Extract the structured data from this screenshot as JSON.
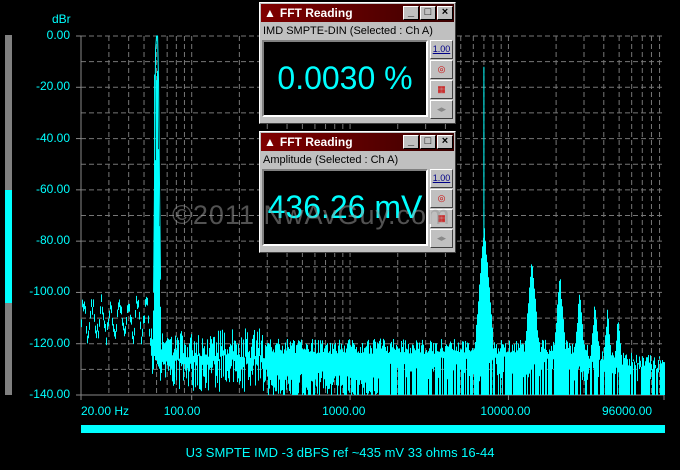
{
  "chart_data": {
    "type": "line",
    "ylabel": "dBr",
    "ylim": [
      -140,
      0
    ],
    "xlim": [
      20,
      96000
    ],
    "xscale": "log",
    "grid": true,
    "yticks": [
      "0.00",
      "-20.00",
      "-40.00",
      "-60.00",
      "-80.00",
      "-100.00",
      "-120.00",
      "-140.00"
    ],
    "xticks": [
      {
        "v": 20,
        "label": "20.00 Hz"
      },
      {
        "v": 100,
        "label": "100.00"
      },
      {
        "v": 1000,
        "label": "1000.00"
      },
      {
        "v": 10000,
        "label": "10000.00"
      },
      {
        "v": 96000,
        "label": "96000.00"
      }
    ],
    "peaks": [
      {
        "x": 60,
        "y": 0
      },
      {
        "x": 7000,
        "y": -72
      },
      {
        "x": 14000,
        "y": -85
      },
      {
        "x": 21000,
        "y": -92
      },
      {
        "x": 28000,
        "y": -98
      },
      {
        "x": 35000,
        "y": -102
      },
      {
        "x": 42000,
        "y": -105
      },
      {
        "x": 49000,
        "y": -108
      }
    ],
    "noise_floor_db": -122,
    "color": "#00ffff"
  },
  "caption": "U3 SMPTE IMD -3 dBFS ref ~435 mV 33 ohms 16-44",
  "watermark": "©2011 NwAvGuy.com",
  "level_bar": {
    "fill_from_db": -60,
    "fill_to_db": -104
  },
  "windows": [
    {
      "title": "FFT Reading",
      "subtitle": "IMD SMPTE-DIN (Selected : Ch A)",
      "value": "0.0030 %"
    },
    {
      "title": "FFT Reading",
      "subtitle": "Amplitude (Selected : Ch A)",
      "value": "436.26 mV"
    }
  ],
  "window_buttons": {
    "minimize": "_",
    "maximize": "□",
    "close": "×"
  },
  "tool_labels": {
    "scale": "1.00"
  }
}
